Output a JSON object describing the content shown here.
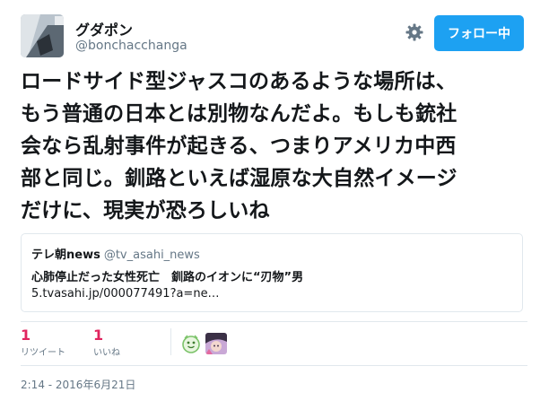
{
  "user": {
    "display_name": "グダポン",
    "handle": "@bonchacchanga"
  },
  "actions": {
    "settings_icon": "gear-icon",
    "follow_label": "フォロー中",
    "follow_color": "#1da1f2"
  },
  "tweet": {
    "text": "ロードサイド型ジャスコのあるような場所は、\nもう普通の日本とは別物なんだよ。もしも銃社\n会なら乱射事件が起きる、つまりアメリカ中西\n部と同じ。釧路といえば湿原な大自然イメージ\nだけに、現実が恐ろしいね"
  },
  "quote": {
    "name": "テレ朝news",
    "handle": "@tv_asahi_news",
    "title": "心肺停止だった女性死亡　釧路のイオンに“刃物”男",
    "link": "5.tvasahi.jp/000077491?a=ne…"
  },
  "stats": {
    "retweets": {
      "count": "1",
      "label": "リツイート"
    },
    "likes": {
      "count": "1",
      "label": "いいね"
    },
    "accent_color": "#e0245e"
  },
  "timestamp": "2:14 - 2016年6月21日"
}
